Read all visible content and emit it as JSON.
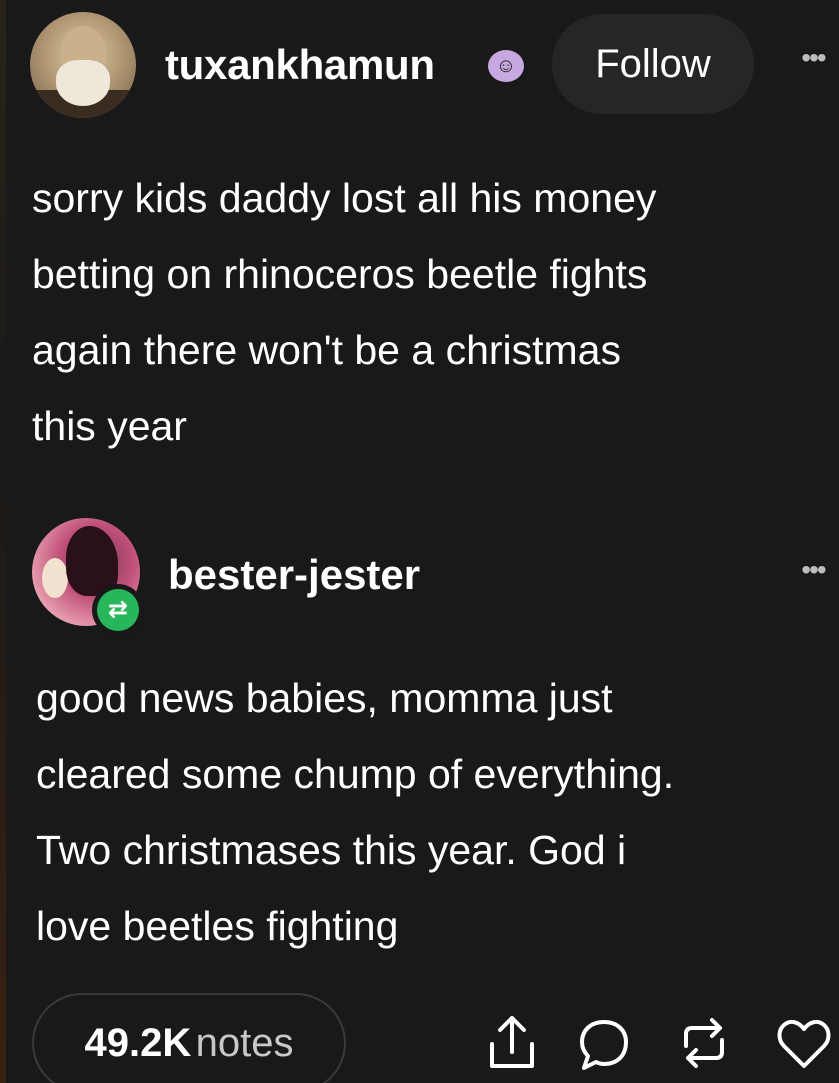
{
  "post": {
    "author": "tuxankhamun",
    "author_badge_icon": "ghost-badge-icon",
    "follow_label": "Follow",
    "more_icon": "ellipsis-icon",
    "text": "sorry kids daddy lost all his money\nbetting on rhinoceros beetle fights\nagain there won't be a christmas\nthis year"
  },
  "reblog": {
    "author": "bester-jester",
    "reblog_badge_icon": "reblog-icon",
    "more_icon": "ellipsis-icon",
    "text": "good news babies, momma just\ncleared some chump of everything.\nTwo christmases this year. God i\nlove beetles fighting"
  },
  "footer": {
    "notes_count": "49.2K",
    "notes_label": "notes",
    "actions": [
      "share-icon",
      "comment-icon",
      "reblog-icon",
      "like-icon"
    ]
  },
  "colors": {
    "background": "#191919",
    "follow_button_bg": "#262626",
    "reblog_badge": "#27b65a",
    "text": "#ffffff"
  }
}
